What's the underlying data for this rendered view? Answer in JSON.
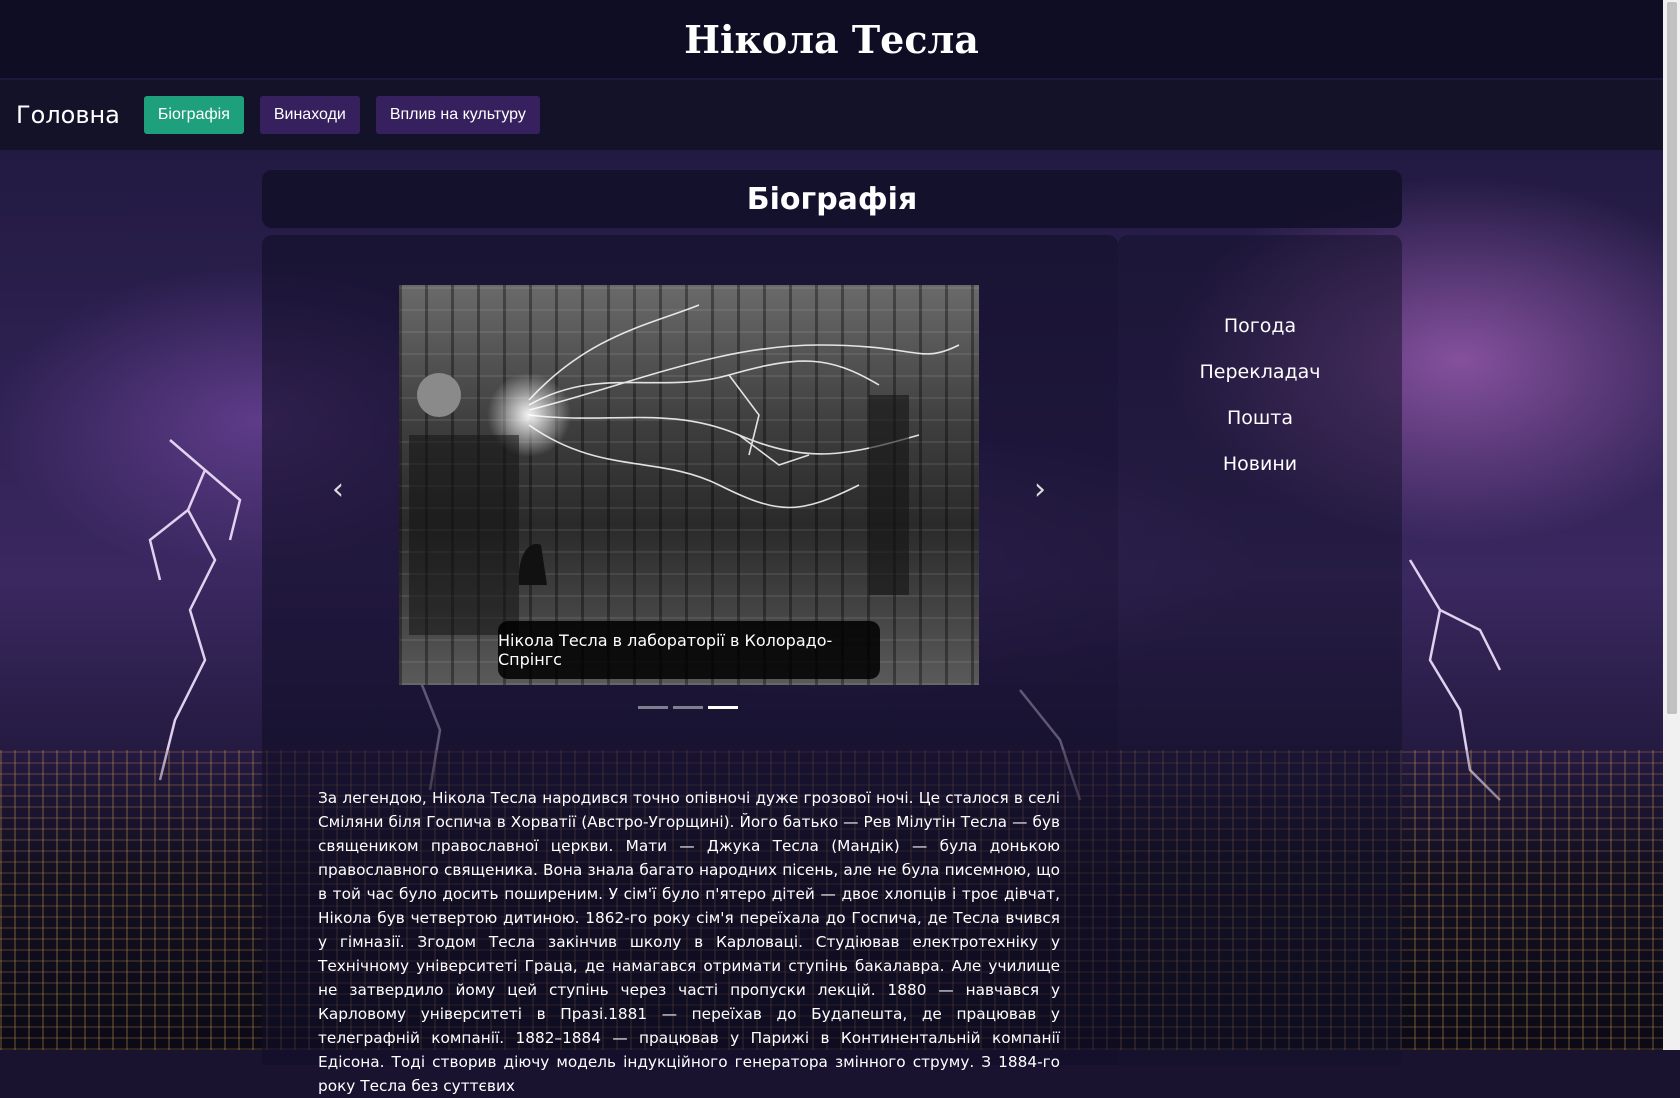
{
  "header": {
    "title": "Нікола Тесла"
  },
  "navbar": {
    "brand": "Головна",
    "items": [
      {
        "label": "Біографія",
        "active": true
      },
      {
        "label": "Винаходи",
        "active": false
      },
      {
        "label": "Вплив на культуру",
        "active": false
      }
    ]
  },
  "section": {
    "title": "Біографія"
  },
  "carousel": {
    "caption": "Нікола Тесла в лабораторії в Колорадо-Спрінгс",
    "slides_count": 3,
    "active_index": 2,
    "prev_icon": "chevron-left-icon",
    "next_icon": "chevron-right-icon"
  },
  "sidebar": {
    "items": [
      "Погода",
      "Перекладач",
      "Пошта",
      "Новини"
    ]
  },
  "biography": {
    "text": "За легендою, Нікола Тесла народився точно опівночі дуже грозової ночі. Це сталося в селі Сміляни біля Госпича в Хорватії (Австро-Угорщині). Його батько — Рев Мілутін Тесла — був священиком православної церкви. Мати — Джука Тесла (Мандік) — була донькою православного священика. Вона знала багато народних пісень, але не була писемною, що в той час було досить поширеним. У сім'ї було п'ятеро дітей — двоє хлопців і троє дівчат, Нікола був четвертою дитиною. 1862-го року сім'я переїхала до Госпича, де Тесла вчився у гімназії. Згодом Тесла закінчив школу в Карловаці. Студіював електротехніку у Технічному університеті Граца, де намагався отримати ступінь бакалавра. Але училище не затвердило йому цей ступінь через часті пропуски лекцій. 1880 — навчався у Карловому університеті в Празі.1881 — переїхав до Будапешта, де працював у телеграфній компанії. 1882–1884 — працював у Парижі в Континентальній компанії Едісона. Тоді створив діючу модель індукційного генератора змінного струму. З 1884-го року Тесла без суттєвих"
  },
  "colors": {
    "header_bg": "#0e0d24",
    "navbar_bg": "#141228",
    "active_button": "#1fa07d",
    "inactive_button": "#36205e"
  }
}
